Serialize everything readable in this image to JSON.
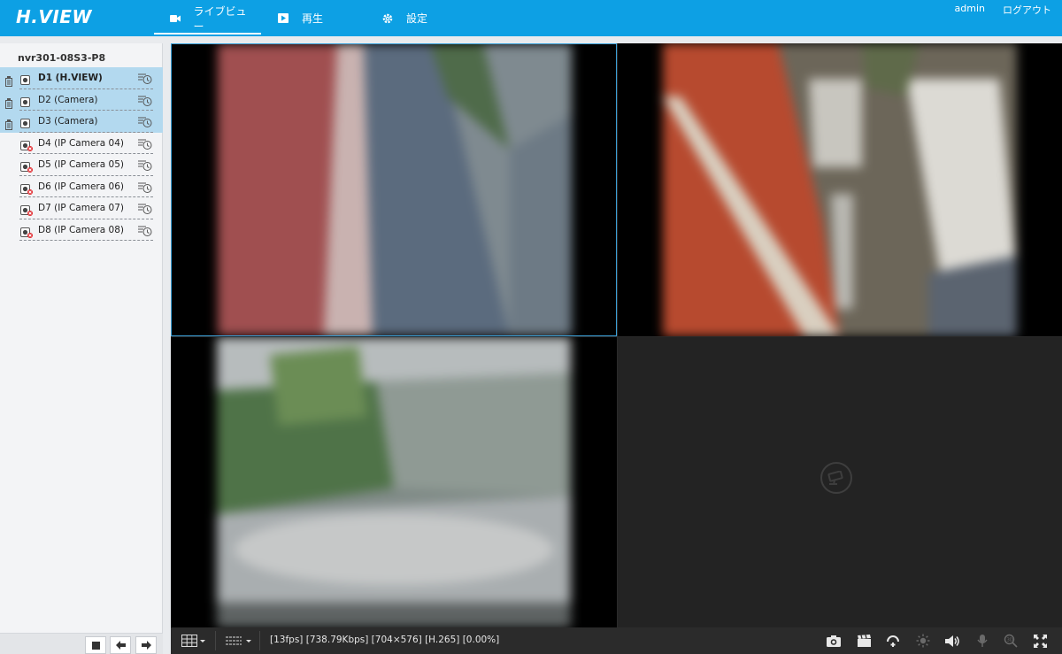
{
  "header": {
    "logo_text": "H.VIEW",
    "nav": [
      {
        "label": "ライブビュー",
        "icon": "video-icon",
        "active": true
      },
      {
        "label": "再生",
        "icon": "playback-icon",
        "active": false
      },
      {
        "label": "設定",
        "icon": "gear-icon",
        "active": false
      }
    ],
    "user": "admin",
    "logout": "ログアウト"
  },
  "sidebar": {
    "device_name": "nvr301-08S3-P8",
    "channels": [
      {
        "label": "D1 (H.VIEW)",
        "online": true,
        "selected": true,
        "bold": true
      },
      {
        "label": "D2 (Camera)",
        "online": true,
        "selected": true,
        "bold": false
      },
      {
        "label": "D3 (Camera)",
        "online": true,
        "selected": true,
        "bold": false
      },
      {
        "label": "D4 (IP Camera 04)",
        "online": false,
        "selected": false,
        "bold": false
      },
      {
        "label": "D5 (IP Camera 05)",
        "online": false,
        "selected": false,
        "bold": false
      },
      {
        "label": "D6 (IP Camera 06)",
        "online": false,
        "selected": false,
        "bold": false
      },
      {
        "label": "D7 (IP Camera 07)",
        "online": false,
        "selected": false,
        "bold": false
      },
      {
        "label": "D8 (IP Camera 08)",
        "online": false,
        "selected": false,
        "bold": false
      }
    ]
  },
  "toolbar": {
    "status_text": "[13fps] [738.79Kbps] [704×576] [H.265] [0.00%]"
  },
  "colors": {
    "header_bg": "#0da0e4",
    "selected_row": "#b3d9ef",
    "active_cell_border": "#3aa0d8",
    "toolbar_bg": "#2b2b2b"
  }
}
